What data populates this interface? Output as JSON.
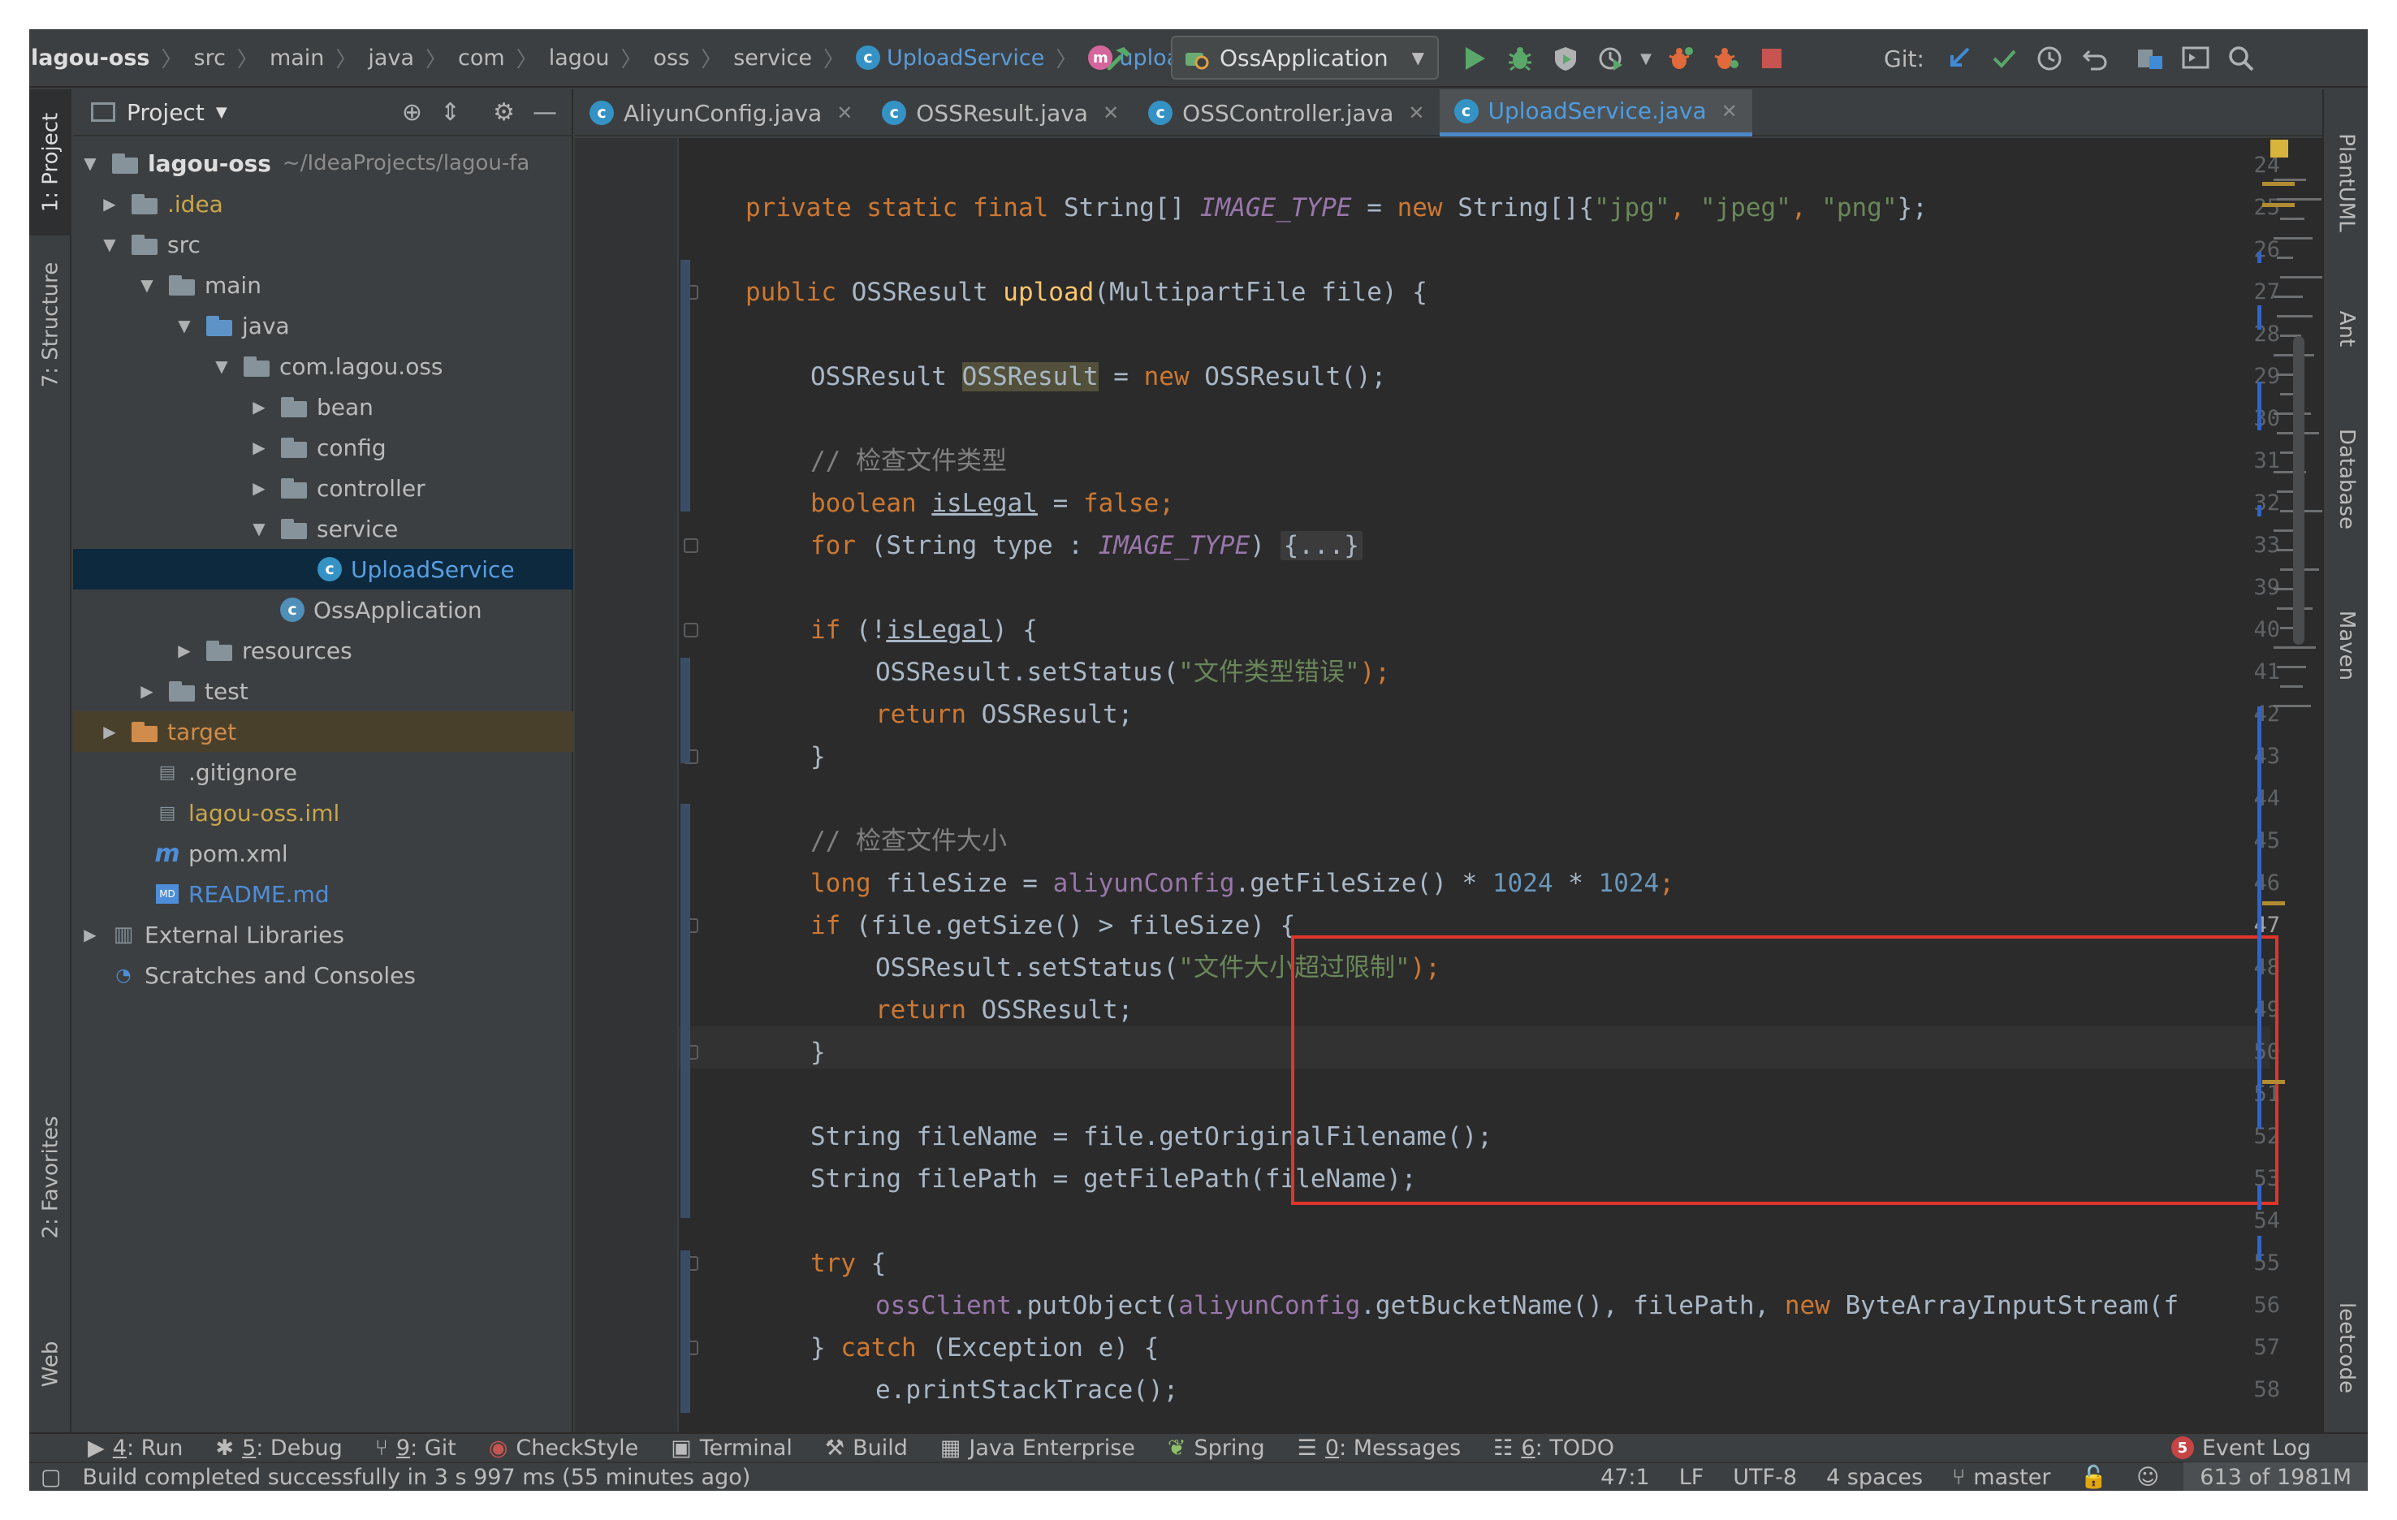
{
  "breadcrumbs": [
    "lagou-oss",
    "src",
    "main",
    "java",
    "com",
    "lagou",
    "oss",
    "service",
    "UploadService",
    "upload"
  ],
  "run_config": "OssApplication",
  "git_label": "Git:",
  "left_tabs": [
    "1: Project",
    "7: Structure",
    "2: Favorites",
    "Web"
  ],
  "right_tabs": [
    "PlantUML",
    "Ant",
    "Database",
    "Maven",
    "leetcode"
  ],
  "project_panel": {
    "title": "Project",
    "tree": [
      {
        "label": "lagou-oss",
        "extra": "~/IdeaProjects/lagou-fa"
      },
      {
        "label": ".idea"
      },
      {
        "label": "src"
      },
      {
        "label": "main"
      },
      {
        "label": "java"
      },
      {
        "label": "com.lagou.oss"
      },
      {
        "label": "bean"
      },
      {
        "label": "config"
      },
      {
        "label": "controller"
      },
      {
        "label": "service"
      },
      {
        "label": "UploadService"
      },
      {
        "label": "OssApplication"
      },
      {
        "label": "resources"
      },
      {
        "label": "test"
      },
      {
        "label": "target"
      },
      {
        "label": ".gitignore"
      },
      {
        "label": "lagou-oss.iml"
      },
      {
        "label": "pom.xml"
      },
      {
        "label": "README.md"
      },
      {
        "label": "External Libraries"
      },
      {
        "label": "Scratches and Consoles"
      }
    ]
  },
  "editor_tabs": [
    {
      "label": "AliyunConfig.java",
      "active": false
    },
    {
      "label": "OSSResult.java",
      "active": false
    },
    {
      "label": "OSSController.java",
      "active": false
    },
    {
      "label": "UploadService.java",
      "active": true
    }
  ],
  "line_numbers": [
    "24",
    "25",
    "26",
    "27",
    "28",
    "29",
    "30",
    "31",
    "32",
    "33",
    "39",
    "40",
    "41",
    "42",
    "43",
    "44",
    "45",
    "46",
    "47",
    "48",
    "49",
    "50",
    "51",
    "52",
    "53",
    "54",
    "55",
    "56",
    "57",
    "58"
  ],
  "current_line": "47",
  "code": {
    "l25": {
      "kw1": "private static final",
      "t1": " String[] ",
      "it1": "IMAGE_TYPE",
      "t2": " = ",
      "kw2": "new",
      "t3": " String[]{",
      "s1": "\"jpg\"",
      "c1": ", ",
      "s2": "\"jpeg\"",
      "c2": ", ",
      "s3": "\"png\"",
      "t4": "};"
    },
    "l27": {
      "kw1": "public",
      "t1": " OSSResult ",
      "fn": "upload",
      "t2": "(MultipartFile file) {"
    },
    "l29": {
      "t1": "OSSResult ",
      "hl": "OSSResult",
      "t2": " = ",
      "kw": "new",
      "t3": " OSSResult();"
    },
    "l31": {
      "cmt": "// 检查文件类型"
    },
    "l32": {
      "kw1": "boolean",
      "t1": " ",
      "u": "isLegal",
      "t2": " = ",
      "kw2": "false",
      "t3": ";"
    },
    "l33": {
      "kw": "for",
      "t1": " (String type : ",
      "it": "IMAGE_TYPE",
      "t2": ") ",
      "fold": "{...}"
    },
    "l40": {
      "kw": "if",
      "t1": " (!",
      "u": "isLegal",
      "t2": ") {"
    },
    "l41": {
      "t1": "OSSResult.setStatus(",
      "s": "\"文件类型错误\"",
      "t2": ");"
    },
    "l42": {
      "kw": "return",
      "t1": " OSSResult;"
    },
    "l43": {
      "t1": "}"
    },
    "l45": {
      "cmt": "// 检查文件大小"
    },
    "l46": {
      "kw": "long",
      "t1": " fileSize = ",
      "f": "aliyunConfig",
      "t2": ".getFileSize() * ",
      "n1": "1024",
      "t3": " * ",
      "n2": "1024",
      "t4": ";"
    },
    "l47": {
      "kw": "if",
      "t1": " (file.getSize() > fileSize) {"
    },
    "l48": {
      "t1": "OSSResult.setStatus(",
      "s": "\"文件大小超过限制\"",
      "t2": ");"
    },
    "l49": {
      "kw": "return",
      "t1": " OSSResult;"
    },
    "l50": {
      "t1": "}"
    },
    "l52": {
      "t1": "String fileName = file.getOriginalFilename();"
    },
    "l53": {
      "t1": "String filePath = getFilePath(fileName);"
    },
    "l55": {
      "kw": "try",
      "t1": " {"
    },
    "l56": {
      "f1": "ossClient",
      "t1": ".putObject(",
      "f2": "aliyunConfig",
      "t2": ".getBucketName(), filePath, ",
      "kw": "new",
      "t3": " ByteArrayInputStream(f"
    },
    "l57": {
      "t1": "} ",
      "kw": "catch",
      "t2": " (Exception e) {"
    },
    "l58": {
      "t1": "e.printStackTrace();"
    }
  },
  "bottom_tools": [
    {
      "key": "4",
      "label": "Run"
    },
    {
      "key": "5",
      "label": "Debug"
    },
    {
      "key": "9",
      "label": "Git"
    },
    {
      "key": "",
      "label": "CheckStyle"
    },
    {
      "key": "",
      "label": "Terminal"
    },
    {
      "key": "",
      "label": "Build"
    },
    {
      "key": "",
      "label": "Java Enterprise"
    },
    {
      "key": "",
      "label": "Spring"
    },
    {
      "key": "0",
      "label": "Messages"
    },
    {
      "key": "6",
      "label": "TODO"
    }
  ],
  "event_log": {
    "count": "5",
    "label": "Event Log"
  },
  "status": {
    "message": "Build completed successfully in 3 s 997 ms (55 minutes ago)",
    "position": "47:1",
    "line_sep": "LF",
    "encoding": "UTF-8",
    "indent": "4 spaces",
    "branch": "master",
    "memory": "613 of 1981M"
  },
  "colors": {
    "highlight_box": "#e0352b",
    "accent": "#4a88c7"
  }
}
